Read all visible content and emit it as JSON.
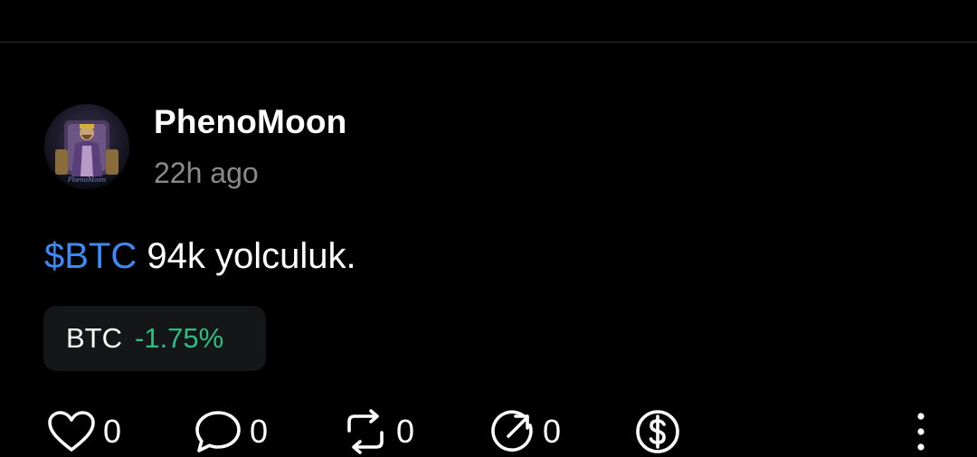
{
  "post": {
    "author": "PhenoMoon",
    "time_ago": "22h ago",
    "cashtag": "$BTC",
    "text": " 94k yolculuk.",
    "avatar_alt": "PhenoMoon"
  },
  "ticker": {
    "symbol": "BTC",
    "change": "-1.75%"
  },
  "actions": {
    "like_count": "0",
    "comment_count": "0",
    "repost_count": "0",
    "share_count": "0"
  },
  "colors": {
    "background": "#000000",
    "cashtag": "#3d8af7",
    "change_positive": "#2ebd85",
    "muted": "#8a8a8a"
  },
  "icons": [
    "heart-icon",
    "comment-icon",
    "repost-icon",
    "share-icon",
    "tip-icon",
    "more-icon"
  ]
}
